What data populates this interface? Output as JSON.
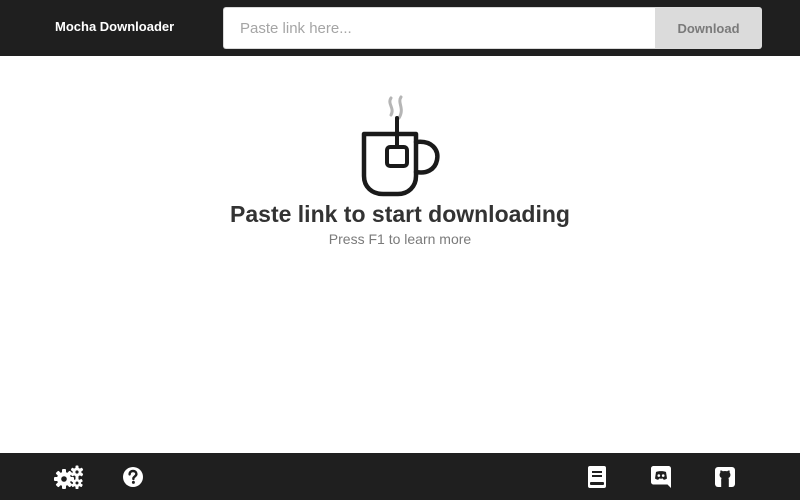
{
  "header": {
    "app_title": "Mocha Downloader",
    "search_placeholder": "Paste link here...",
    "search_value": "",
    "download_label": "Download"
  },
  "empty_state": {
    "icon": "tea-cup-icon",
    "title": "Paste link to start downloading",
    "hint": "Press F1 to learn more"
  },
  "footer": {
    "left_icons": [
      "settings-gears-icon",
      "help-circle-icon"
    ],
    "right_icons": [
      "book-icon",
      "discord-icon",
      "github-icon"
    ]
  },
  "colors": {
    "bar_background": "#1f1f1f",
    "button_background": "#dbdbdb",
    "title_text": "#333333",
    "hint_text": "#7a7a7a"
  }
}
